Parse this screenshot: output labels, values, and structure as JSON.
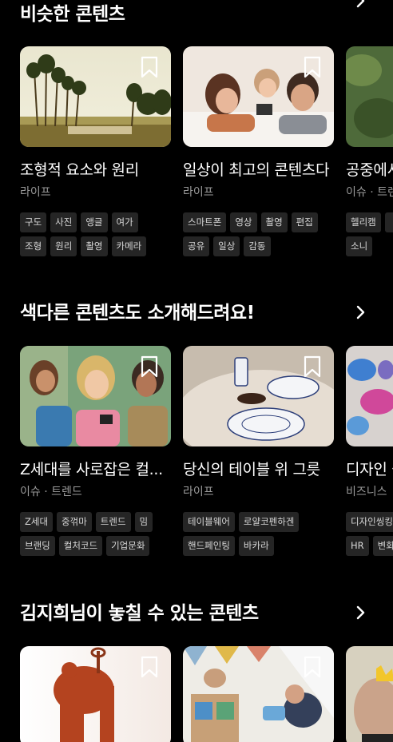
{
  "sections": [
    {
      "title": "비슷한 콘텐츠",
      "cards": [
        {
          "title": "조형적 요소와 원리",
          "sub": "라이프",
          "tags": [
            [
              "구도",
              "사진",
              "앵글",
              "여가"
            ],
            [
              "조형",
              "원리",
              "촬영",
              "카메라"
            ]
          ]
        },
        {
          "title": "일상이 최고의 콘텐츠다",
          "sub": "라이프",
          "tags": [
            [
              "스마트폰",
              "영상",
              "촬영",
              "편집"
            ],
            [
              "공유",
              "일상",
              "감동"
            ]
          ]
        },
        {
          "title": "공중에서",
          "sub": "이슈 · 트렌드",
          "tags": [
            [
              "헬리캠",
              ""
            ],
            [
              "소니"
            ]
          ]
        }
      ]
    },
    {
      "title": "색다른 콘텐츠도 소개해드려요!",
      "cards": [
        {
          "title": "Z세대를 사로잡은 컬...",
          "sub": "이슈 · 트렌드",
          "tags": [
            [
              "Z세대",
              "중꺾마",
              "트렌드",
              "밈"
            ],
            [
              "브랜딩",
              "컬처코드",
              "기업문화"
            ]
          ]
        },
        {
          "title": "당신의 테이블 위 그릇",
          "sub": "라이프",
          "tags": [
            [
              "테이블웨어",
              "로얄코펜하겐"
            ],
            [
              "핸드페인팅",
              "바카라"
            ]
          ]
        },
        {
          "title": "디자인 씽킹",
          "sub": "비즈니스",
          "tags": [
            [
              "디자인씽킹"
            ],
            [
              "HR",
              "변화"
            ]
          ]
        }
      ]
    },
    {
      "title": "김지희님이 놓칠 수 있는 콘텐츠",
      "cards": [
        {
          "title": "",
          "sub": "",
          "tags": []
        },
        {
          "title": "",
          "sub": "",
          "tags": []
        },
        {
          "title": "",
          "sub": "",
          "tags": []
        }
      ]
    }
  ],
  "icons": {
    "bookmark": "bookmark-icon",
    "chevron": "chevron-right-icon"
  }
}
